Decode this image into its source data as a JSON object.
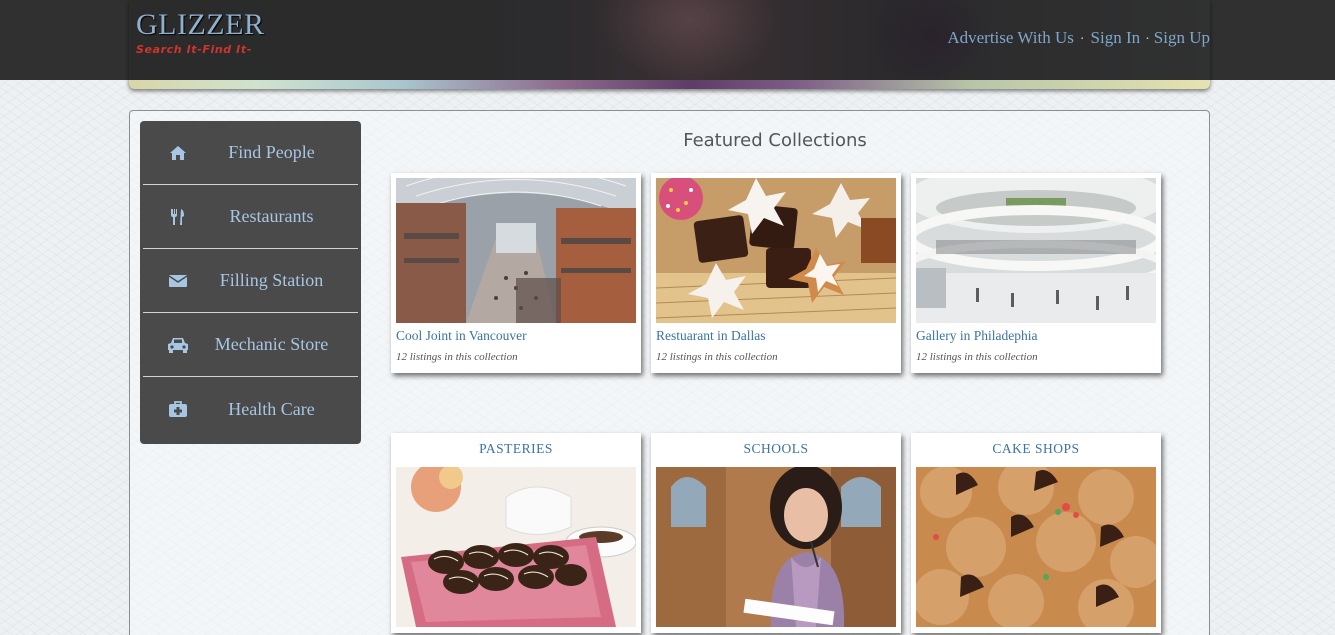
{
  "header": {
    "logo_title": "GLIZZER",
    "logo_tagline": "Search It-Find It-",
    "nav": {
      "advertise": "Advertise With Us",
      "sep1": "·",
      "sign_in": "Sign In",
      "sep2": "·",
      "sign_up": "Sign Up"
    }
  },
  "sidebar": {
    "items": [
      {
        "label": "Find People",
        "icon": "home-icon"
      },
      {
        "label": "Restaurants",
        "icon": "utensils-icon"
      },
      {
        "label": "Filling Station",
        "icon": "envelope-icon"
      },
      {
        "label": "Mechanic Store",
        "icon": "car-icon"
      },
      {
        "label": "Health Care",
        "icon": "medkit-icon"
      }
    ]
  },
  "featured": {
    "title": "Featured Collections",
    "cards": [
      {
        "caption": "Cool Joint in Vancouver",
        "sub": "12 listings in this collection",
        "image": "shopping-mall-arcade"
      },
      {
        "caption": "Restuarant in Dallas",
        "sub": "12 listings in this collection",
        "image": "star-cookies-and-chocolates"
      },
      {
        "caption": "Gallery in Philadephia",
        "sub": "12 listings in this collection",
        "image": "white-mall-interior"
      }
    ]
  },
  "categories": {
    "cards": [
      {
        "title": "PASTERIES",
        "image": "chocolate-pastries-with-teapot"
      },
      {
        "title": "SCHOOLS",
        "image": "student-holding-notebook"
      },
      {
        "title": "CAKE SHOPS",
        "image": "chocolate-kiss-cookies"
      }
    ]
  },
  "colors": {
    "topbar": "#2f302f",
    "sidebar_bg": "#4a4a4a",
    "link": "#3a74a2",
    "nav_link": "#7ea7c9",
    "tagline": "#d0342c"
  }
}
